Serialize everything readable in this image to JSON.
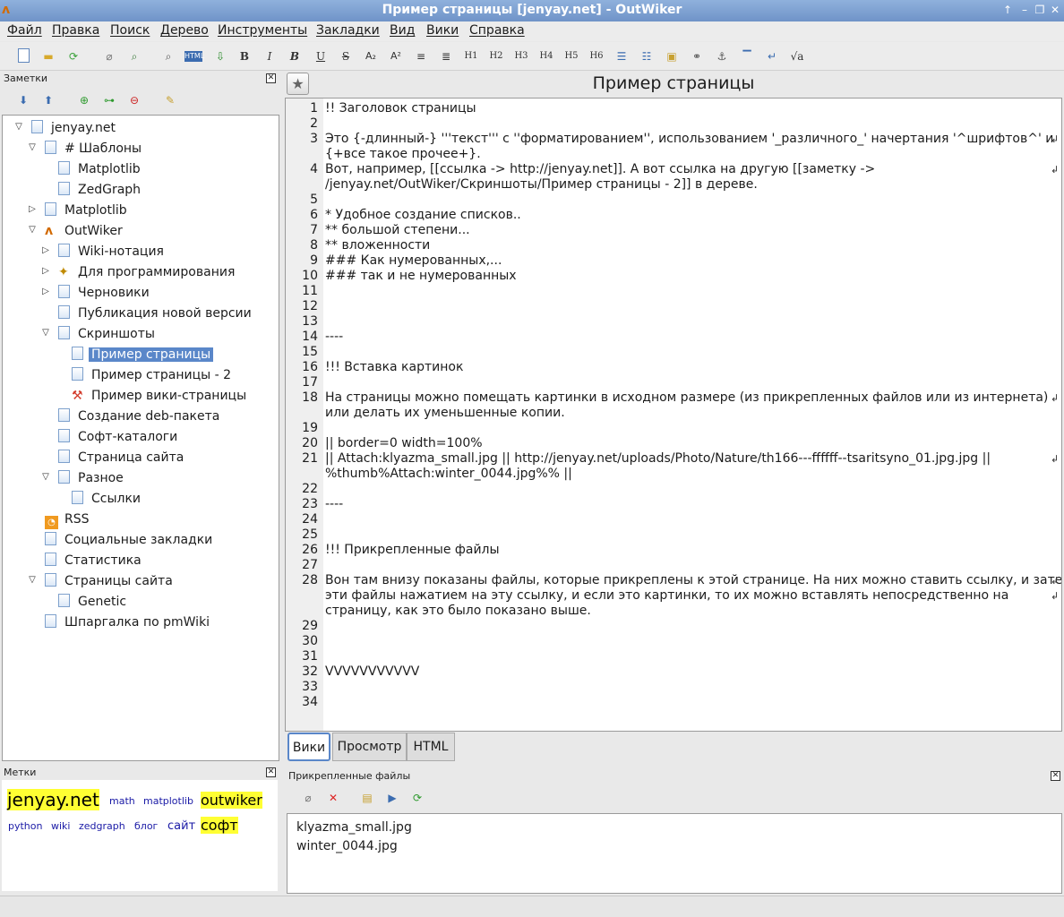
{
  "window": {
    "title": "Пример страницы [jenyay.net] - OutWiker",
    "app_icon": "outwiker-logo"
  },
  "menu": [
    "Файл",
    "Правка",
    "Поиск",
    "Дерево",
    "Инструменты",
    "Закладки",
    "Вид",
    "Вики",
    "Справка"
  ],
  "toolbar": {
    "buttons": [
      "new-page",
      "open",
      "reload",
      "attach",
      "find-in-attachments",
      "find",
      "html-code",
      "bold",
      "italic",
      "bold-italic",
      "underline",
      "strikethrough",
      "subscript",
      "superscript",
      "align-center",
      "align-right",
      "h1",
      "h2",
      "h3",
      "h4",
      "h5",
      "h6",
      "bullet-list",
      "numbered-list",
      "thumbnail",
      "link",
      "anchor",
      "hr",
      "line-break",
      "formula"
    ],
    "labels": {
      "b": "B",
      "i": "I",
      "bi": "B",
      "u": "U",
      "s": "S",
      "sub": "A₂",
      "sup": "A²",
      "h1": "H1",
      "h2": "H2",
      "h3": "H3",
      "h4": "H4",
      "h5": "H5",
      "h6": "H6",
      "formula": "√a"
    }
  },
  "notes_panel": {
    "title": "Заметки"
  },
  "tree": [
    {
      "label": "jenyay.net",
      "level": 0,
      "arrow": "down",
      "icon": "page"
    },
    {
      "label": "# Шаблоны",
      "level": 1,
      "arrow": "down",
      "icon": "page"
    },
    {
      "label": "Matplotlib",
      "level": 2,
      "arrow": "",
      "icon": "page"
    },
    {
      "label": "ZedGraph",
      "level": 2,
      "arrow": "",
      "icon": "page"
    },
    {
      "label": "Matplotlib",
      "level": 1,
      "arrow": "right",
      "icon": "page"
    },
    {
      "label": "OutWiker",
      "level": 1,
      "arrow": "down",
      "icon": "outwiker"
    },
    {
      "label": "Wiki-нотация",
      "level": 2,
      "arrow": "right",
      "icon": "page"
    },
    {
      "label": "Для программирования",
      "level": 2,
      "arrow": "right",
      "icon": "wand"
    },
    {
      "label": "Черновики",
      "level": 2,
      "arrow": "right",
      "icon": "page"
    },
    {
      "label": "Публикация новой версии",
      "level": 2,
      "arrow": "",
      "icon": "page"
    },
    {
      "label": "Скриншоты",
      "level": 2,
      "arrow": "down",
      "icon": "page"
    },
    {
      "label": "Пример страницы",
      "level": 3,
      "arrow": "",
      "icon": "page",
      "selected": true
    },
    {
      "label": "Пример страницы - 2",
      "level": 3,
      "arrow": "",
      "icon": "page"
    },
    {
      "label": "Пример вики-страницы",
      "level": 3,
      "arrow": "",
      "icon": "hammer"
    },
    {
      "label": "Создание deb-пакета",
      "level": 2,
      "arrow": "",
      "icon": "page"
    },
    {
      "label": "Софт-каталоги",
      "level": 2,
      "arrow": "",
      "icon": "page"
    },
    {
      "label": "Страница сайта",
      "level": 2,
      "arrow": "",
      "icon": "page"
    },
    {
      "label": "Разное",
      "level": 2,
      "arrow": "down",
      "icon": "page"
    },
    {
      "label": "Ссылки",
      "level": 3,
      "arrow": "",
      "icon": "page"
    },
    {
      "label": "RSS",
      "level": 1,
      "arrow": "",
      "icon": "rss"
    },
    {
      "label": "Социальные закладки",
      "level": 1,
      "arrow": "",
      "icon": "page"
    },
    {
      "label": "Статистика",
      "level": 1,
      "arrow": "",
      "icon": "page"
    },
    {
      "label": "Страницы сайта",
      "level": 1,
      "arrow": "down",
      "icon": "page"
    },
    {
      "label": "Genetic",
      "level": 2,
      "arrow": "",
      "icon": "page"
    },
    {
      "label": "Шпаргалка по pmWiki",
      "level": 1,
      "arrow": "",
      "icon": "page"
    }
  ],
  "tags_panel": {
    "title": "Метки",
    "tags": [
      {
        "label": "jenyay.net",
        "size": "xl",
        "highlight": true
      },
      {
        "label": "math",
        "size": "s",
        "highlight": false
      },
      {
        "label": "matplotlib",
        "size": "s",
        "highlight": false
      },
      {
        "label": "outwiker",
        "size": "l",
        "highlight": true
      },
      {
        "label": "python",
        "size": "s",
        "highlight": false
      },
      {
        "label": "wiki",
        "size": "s",
        "highlight": false
      },
      {
        "label": "zedgraph",
        "size": "s",
        "highlight": false
      },
      {
        "label": "блог",
        "size": "s",
        "highlight": false
      },
      {
        "label": "сайт",
        "size": "m",
        "highlight": false
      },
      {
        "label": "софт",
        "size": "l",
        "highlight": true
      }
    ]
  },
  "editor": {
    "page_title": "Пример страницы",
    "lines": [
      {
        "n": "1",
        "text": [
          "!! Заголовок страницы"
        ]
      },
      {
        "n": "2",
        "text": [
          ""
        ]
      },
      {
        "n": "3",
        "text": [
          "Это {-длинный-} '''текст''' с ''форматированием'', использованием '_различного_' начертания '^шрифтов^' и",
          "{+все такое прочее+}."
        ]
      },
      {
        "n": "4",
        "text": [
          "Вот, например, [[ссылка -> http://jenyay.net]]. А вот ссылка на другую [[заметку ->",
          "/jenyay.net/OutWiker/Скриншоты/Пример страницы - 2]] в дереве."
        ]
      },
      {
        "n": "5",
        "text": [
          ""
        ]
      },
      {
        "n": "6",
        "text": [
          "* Удобное создание списков.."
        ]
      },
      {
        "n": "7",
        "text": [
          "** большой степени..."
        ]
      },
      {
        "n": "8",
        "text": [
          "** вложенности"
        ]
      },
      {
        "n": "9",
        "text": [
          "### Как нумерованных,..."
        ]
      },
      {
        "n": "10",
        "text": [
          "### так и не нумерованных"
        ]
      },
      {
        "n": "11",
        "text": [
          ""
        ]
      },
      {
        "n": "12",
        "text": [
          ""
        ]
      },
      {
        "n": "13",
        "text": [
          ""
        ]
      },
      {
        "n": "14",
        "text": [
          "----"
        ]
      },
      {
        "n": "15",
        "text": [
          ""
        ]
      },
      {
        "n": "16",
        "text": [
          "!!! Вставка картинок"
        ]
      },
      {
        "n": "17",
        "text": [
          ""
        ]
      },
      {
        "n": "18",
        "text": [
          "На страницы можно помещать картинки в исходном размере (из прикрепленных файлов или из интернета)",
          "или делать их уменьшенные копии."
        ]
      },
      {
        "n": "19",
        "text": [
          ""
        ]
      },
      {
        "n": "20",
        "text": [
          "|| border=0 width=100%"
        ]
      },
      {
        "n": "21",
        "text": [
          "|| Attach:klyazma_small.jpg || http://jenyay.net/uploads/Photo/Nature/th166---ffffff--tsaritsyno_01.jpg.jpg ||",
          "%thumb%Attach:winter_0044.jpg%% ||"
        ]
      },
      {
        "n": "22",
        "text": [
          ""
        ]
      },
      {
        "n": "23",
        "text": [
          "----"
        ]
      },
      {
        "n": "24",
        "text": [
          ""
        ]
      },
      {
        "n": "25",
        "text": [
          ""
        ]
      },
      {
        "n": "26",
        "text": [
          "!!! Прикрепленные файлы"
        ]
      },
      {
        "n": "27",
        "text": [
          ""
        ]
      },
      {
        "n": "28",
        "text": [
          "Вон там внизу показаны файлы, которые прикреплены к этой странице. На них можно ставить ссылку, и затем",
          "эти файлы нажатием на эту ссылку, и если это картинки, то их можно вставлять непосредственно на",
          "страницу, как это было показано выше."
        ]
      },
      {
        "n": "29",
        "text": [
          ""
        ]
      },
      {
        "n": "30",
        "text": [
          ""
        ]
      },
      {
        "n": "31",
        "text": [
          ""
        ]
      },
      {
        "n": "32",
        "text": [
          "VVVVVVVVVVV"
        ]
      },
      {
        "n": "33",
        "text": [
          ""
        ]
      },
      {
        "n": "34",
        "text": [
          ""
        ]
      }
    ]
  },
  "view_tabs": [
    "Вики",
    "Просмотр",
    "HTML"
  ],
  "attachments": {
    "title": "Прикрепленные файлы",
    "files": [
      "klyazma_small.jpg",
      "winter_0044.jpg"
    ]
  }
}
